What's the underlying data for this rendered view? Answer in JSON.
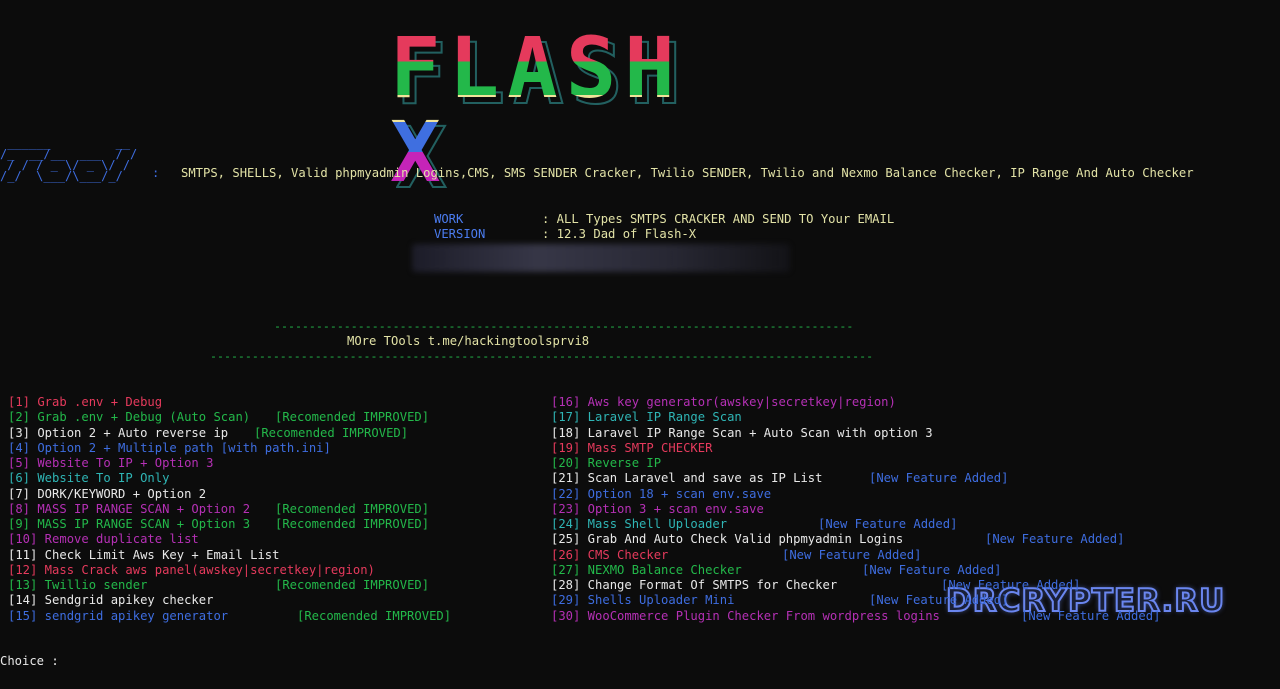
{
  "banner": {
    "logo_text": "FLASH X"
  },
  "mini_logo": {
    "ascii": " ______         __\n/_  __/__  ___  / /\n / / / _ \\/ _ \\/ / \n/_/  \\___/\\___/_/  "
  },
  "tagline": {
    "colon": ":",
    "text": "SMTPS, SHELLS, Valid phpmyadmin Logins,CMS, SMS SENDER Cracker, Twilio SENDER, Twilio and Nexmo Balance Checker, IP Range And Auto Checker"
  },
  "info": {
    "work_label": "WORK",
    "work_value": ": ALL Types SMTPS CRACKER AND SEND TO Your EMAIL",
    "version_label": "VERSION",
    "version_value": ": 12.3 Dad of Flash-X"
  },
  "separator": {
    "top": "-----------------------------------------------------------------------------------",
    "more_tools": "MOre TOols t.me/hackingtoolsprvi8",
    "bottom": "-----------------------------------------------------------------------------------------------"
  },
  "menu_left": [
    {
      "text": "[1] Grab .env + Debug",
      "color": "#e53a5c"
    },
    {
      "text": "[2] Grab .env + Debug (Auto Scan)",
      "color": "#23b84a",
      "tag": "[Recomended IMPROVED]"
    },
    {
      "text": "[3] Option 2 + Auto reverse ip",
      "color": "#e8e8e8",
      "tag": "[Recomended IMPROVED]"
    },
    {
      "text": "[4] Option 2 + Multiple path [with path.ini]",
      "color": "#3e6de0"
    },
    {
      "text": "[5] Website To IP + Option 3",
      "color": "#b530b5"
    },
    {
      "text": "[6] Website To IP Only",
      "color": "#2fb5b5"
    },
    {
      "text": "[7] DORK/KEYWORD + Option 2",
      "color": "#e8e8e8"
    },
    {
      "text": "[8] MASS IP RANGE SCAN + Option 2",
      "color": "#b530b5",
      "tag": "[Recomended IMPROVED]"
    },
    {
      "text": "[9] MASS IP RANGE SCAN + Option 3",
      "color": "#23b84a",
      "tag": "[Recomended IMPROVED]"
    },
    {
      "text": "[10] Remove duplicate list",
      "color": "#b530b5"
    },
    {
      "text": "[11] Check Limit Aws Key + Email List",
      "color": "#e8e8e8"
    },
    {
      "text": "[12] Mass Crack aws panel(awskey|secretkey|region)",
      "color": "#e53a5c"
    },
    {
      "text": "[13] Twillio sender",
      "color": "#23b84a",
      "tag": "[Recomended IMPROVED]"
    },
    {
      "text": "[14] Sendgrid apikey checker",
      "color": "#e8e8e8"
    },
    {
      "text": "[15] sendgrid apikey generator",
      "color": "#3e6de0",
      "tag": "[Recomended IMPROVED]"
    }
  ],
  "menu_right": [
    {
      "text": "[16] Aws key generator(awskey|secretkey|region)",
      "color": "#b530b5"
    },
    {
      "text": "[17] Laravel IP Range Scan",
      "color": "#2fb5b5"
    },
    {
      "text": "[18] Laravel IP Range Scan + Auto Scan with option 3",
      "color": "#e8e8e8"
    },
    {
      "text": "[19] Mass SMTP CHECKER",
      "color": "#e53a5c"
    },
    {
      "text": "[20] Reverse IP",
      "color": "#23b84a"
    },
    {
      "text": "[21] Scan Laravel and save as IP List",
      "color": "#e8e8e8",
      "tag": "[New Feature Added]"
    },
    {
      "text": "[22] Option 18 + scan env.save",
      "color": "#3e6de0"
    },
    {
      "text": "[23] Option 3 + scan env.save",
      "color": "#b530b5"
    },
    {
      "text": "[24] Mass Shell Uploader",
      "color": "#2fb5b5",
      "tag": "[New Feature Added]"
    },
    {
      "text": "[25] Grab And Auto Check Valid phpmyadmin Logins",
      "color": "#e8e8e8",
      "tag": "[New Feature Added]"
    },
    {
      "text": "[26] CMS Checker",
      "color": "#e53a5c",
      "tag": "[New Feature Added]"
    },
    {
      "text": "[27] NEXMO Balance Checker",
      "color": "#23b84a",
      "tag": "[New Feature Added]"
    },
    {
      "text": "[28] Change Format Of SMTPS for Checker",
      "color": "#e8e8e8",
      "tag": "[New Feature Added]"
    },
    {
      "text": "[29] Shells Uploader Mini",
      "color": "#3e6de0",
      "tag": "[New Feature Added]"
    },
    {
      "text": "[30] WooCommerce Plugin Checker From wordpress logins",
      "color": "#b530b5",
      "tag": "[New Feature Added]"
    }
  ],
  "watermark": {
    "text": "DRCRYPTER.RU"
  },
  "prompt": {
    "text": "Choice :"
  }
}
